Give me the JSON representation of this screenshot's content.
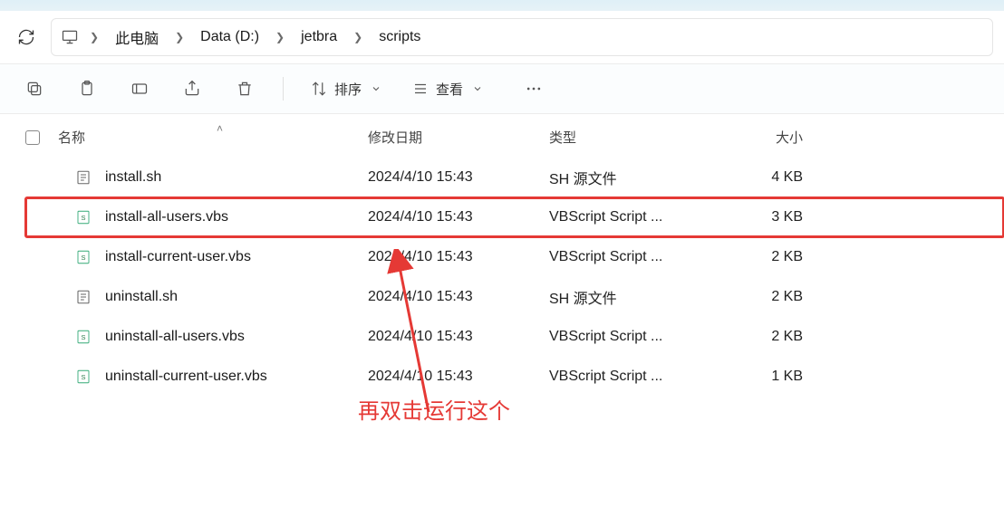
{
  "breadcrumb": {
    "segments": [
      "此电脑",
      "Data (D:)",
      "jetbra",
      "scripts"
    ]
  },
  "toolbar": {
    "sort_label": "排序",
    "view_label": "查看"
  },
  "columns": {
    "name": "名称",
    "date": "修改日期",
    "type": "类型",
    "size": "大小"
  },
  "files": [
    {
      "name": "install.sh",
      "date": "2024/4/10 15:43",
      "type": "SH 源文件",
      "size": "4 KB",
      "icon": "sh"
    },
    {
      "name": "install-all-users.vbs",
      "date": "2024/4/10 15:43",
      "type": "VBScript Script ...",
      "size": "3 KB",
      "icon": "vbs",
      "highlight": true
    },
    {
      "name": "install-current-user.vbs",
      "date": "2024/4/10 15:43",
      "type": "VBScript Script ...",
      "size": "2 KB",
      "icon": "vbs"
    },
    {
      "name": "uninstall.sh",
      "date": "2024/4/10 15:43",
      "type": "SH 源文件",
      "size": "2 KB",
      "icon": "sh"
    },
    {
      "name": "uninstall-all-users.vbs",
      "date": "2024/4/10 15:43",
      "type": "VBScript Script ...",
      "size": "2 KB",
      "icon": "vbs"
    },
    {
      "name": "uninstall-current-user.vbs",
      "date": "2024/4/10 15:43",
      "type": "VBScript Script ...",
      "size": "1 KB",
      "icon": "vbs"
    }
  ],
  "annotation": {
    "text": "再双击运行这个",
    "color": "#e53935"
  }
}
